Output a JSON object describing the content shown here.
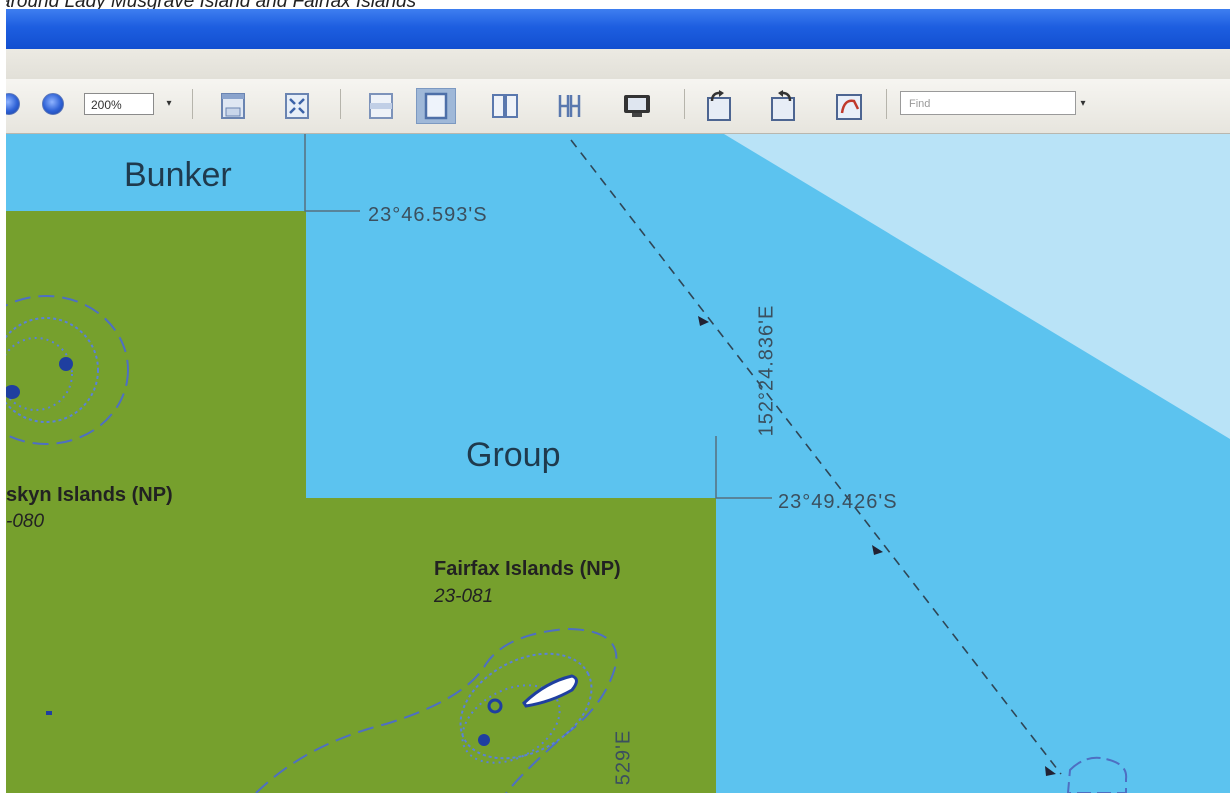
{
  "caption": "around Lady Musgrave Island and Fairfax Islands",
  "toolbar": {
    "zoom_value": "200%",
    "find_placeholder": "Find"
  },
  "map": {
    "region_labels": {
      "bunker": "Bunker",
      "group": "Group"
    },
    "islands": [
      {
        "name": "skyn Islands (NP)",
        "code": "-080"
      },
      {
        "name": "Fairfax Islands (NP)",
        "code": "23-081"
      }
    ],
    "coordinates": {
      "lat_1": "23°46.593'S",
      "lat_2": "23°49.426'S",
      "lon_1": "152°24.836'E",
      "lon_2": "529'E"
    },
    "colors": {
      "park_green": "#76a02d",
      "water_blue": "#5cc3ef",
      "light_blue": "#b9e3f7",
      "reef_blue": "#4e6fc2"
    }
  }
}
